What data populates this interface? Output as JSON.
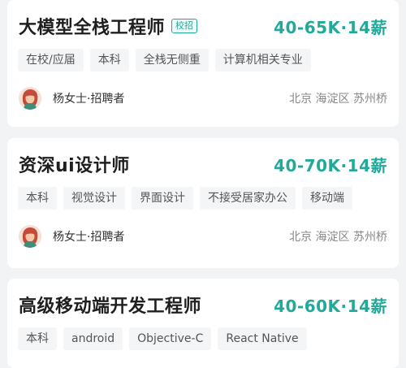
{
  "jobs": [
    {
      "title": "大模型全栈工程师",
      "badge": "校招",
      "salary": "40-65K·14薪",
      "tags": [
        "在校/应届",
        "本科",
        "全栈无侧重",
        "计算机相关专业"
      ],
      "recruiter": "杨女士·招聘者",
      "location": "北京  海淀区  苏州桥"
    },
    {
      "title": "资深ui设计师",
      "salary": "40-70K·14薪",
      "tags": [
        "本科",
        "视觉设计",
        "界面设计",
        "不接受居家办公",
        "移动端"
      ],
      "recruiter": "杨女士·招聘者",
      "location": "北京  海淀区  苏州桥"
    },
    {
      "title": "高级移动端开发工程师",
      "salary": "40-60K·14薪",
      "tags": [
        "本科",
        "android",
        "Objective-C",
        "React Native"
      ]
    }
  ],
  "colors": {
    "accent": "#22a99a",
    "background": "#f2f3f5",
    "card": "#ffffff",
    "tag_background": "#f4f5f7"
  },
  "icons": {
    "avatar": "recruiter-avatar-icon"
  }
}
